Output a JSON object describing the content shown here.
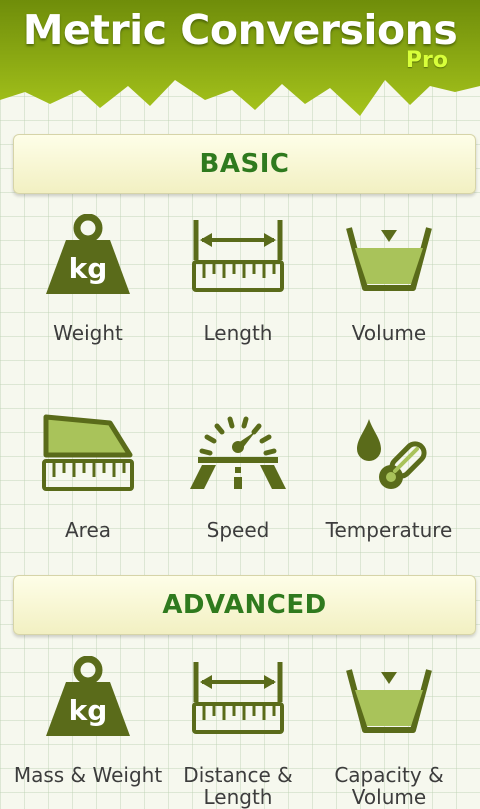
{
  "header": {
    "title": "Metric Conversions",
    "subtitle": "Pro"
  },
  "sections": {
    "basic": {
      "label": "BASIC",
      "items": [
        {
          "label": "Weight",
          "icon": "kg-weight-icon"
        },
        {
          "label": "Length",
          "icon": "ruler-icon"
        },
        {
          "label": "Volume",
          "icon": "beaker-icon"
        },
        {
          "label": "Area",
          "icon": "area-ruler-icon"
        },
        {
          "label": "Speed",
          "icon": "speedometer-icon"
        },
        {
          "label": "Temperature",
          "icon": "thermometer-icon"
        }
      ]
    },
    "advanced": {
      "label": "ADVANCED",
      "items": [
        {
          "label": "Mass & Weight",
          "icon": "kg-weight-icon"
        },
        {
          "label": "Distance & Length",
          "icon": "ruler-icon"
        },
        {
          "label": "Capacity & Volume",
          "icon": "beaker-icon"
        }
      ]
    }
  },
  "colors": {
    "accent": "#8aa61a",
    "icon": "#5a6b1a",
    "icon_fill": "#a9c35a",
    "heading": "#2f7a1e"
  }
}
